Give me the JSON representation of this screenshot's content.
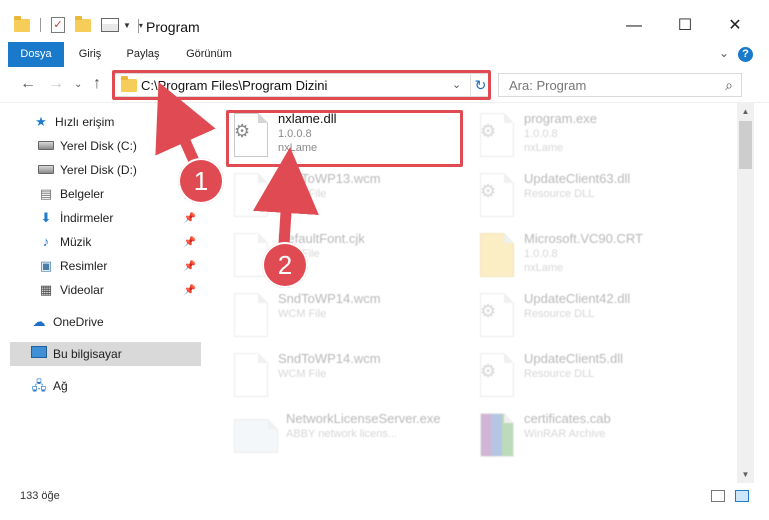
{
  "window": {
    "title": "Program",
    "minimize": "—",
    "maximize": "☐",
    "close": "✕"
  },
  "ribbon": {
    "tabs": [
      "Dosya",
      "Giriş",
      "Paylaş",
      "Görünüm"
    ],
    "collapse_chevron": "⌄",
    "help": "?"
  },
  "address": {
    "path": "C:\\Program Files\\Program Dizini",
    "refresh": "↻",
    "dropdown": "⌄"
  },
  "search": {
    "placeholder": "Ara: Program"
  },
  "nav": {
    "back": "←",
    "forward": "→",
    "recent": "⌄",
    "up": "↑",
    "items": [
      {
        "label": "Hızlı erişim"
      },
      {
        "label": "Yerel Disk (C:)"
      },
      {
        "label": "Yerel Disk (D:)"
      },
      {
        "label": "Belgeler"
      },
      {
        "label": "İndirmeler"
      },
      {
        "label": "Müzik"
      },
      {
        "label": "Resimler"
      },
      {
        "label": "Videolar"
      },
      {
        "label": "OneDrive"
      },
      {
        "label": "Bu bilgisayar"
      },
      {
        "label": "Ağ"
      }
    ]
  },
  "files": [
    {
      "name": "nxlame.dll",
      "line2": "1.0.0.8",
      "line3": "nxLame"
    },
    {
      "name": "program.exe",
      "line2": "1.0.0.8",
      "line3": "nxLame"
    },
    {
      "name": "SndToWP13.wcm",
      "line2": "WCM File",
      "line3": ""
    },
    {
      "name": "UpdateClient63.dll",
      "line2": "Resource DLL",
      "line3": ""
    },
    {
      "name": "DefaultFont.cjk",
      "line2": "CJK File",
      "line3": ""
    },
    {
      "name": "Microsoft.VC90.CRT",
      "line2": "1.0.0.8",
      "line3": "nxLame"
    },
    {
      "name": "SndToWP14.wcm",
      "line2": "WCM File",
      "line3": ""
    },
    {
      "name": "UpdateClient42.dll",
      "line2": "Resource DLL",
      "line3": ""
    },
    {
      "name": "SndToWP14.wcm",
      "line2": "WCM File",
      "line3": ""
    },
    {
      "name": "UpdateClient5.dll",
      "line2": "Resource DLL",
      "line3": ""
    },
    {
      "name": "NetworkLicenseServer.exe",
      "line2": "ABBY network licens...",
      "line3": ""
    },
    {
      "name": "certificates.cab",
      "line2": "WinRAR Archive",
      "line3": ""
    }
  ],
  "status": {
    "count": "133 öğe"
  },
  "annotations": {
    "step1": "1",
    "step2": "2",
    "accent": "#e04b53"
  }
}
